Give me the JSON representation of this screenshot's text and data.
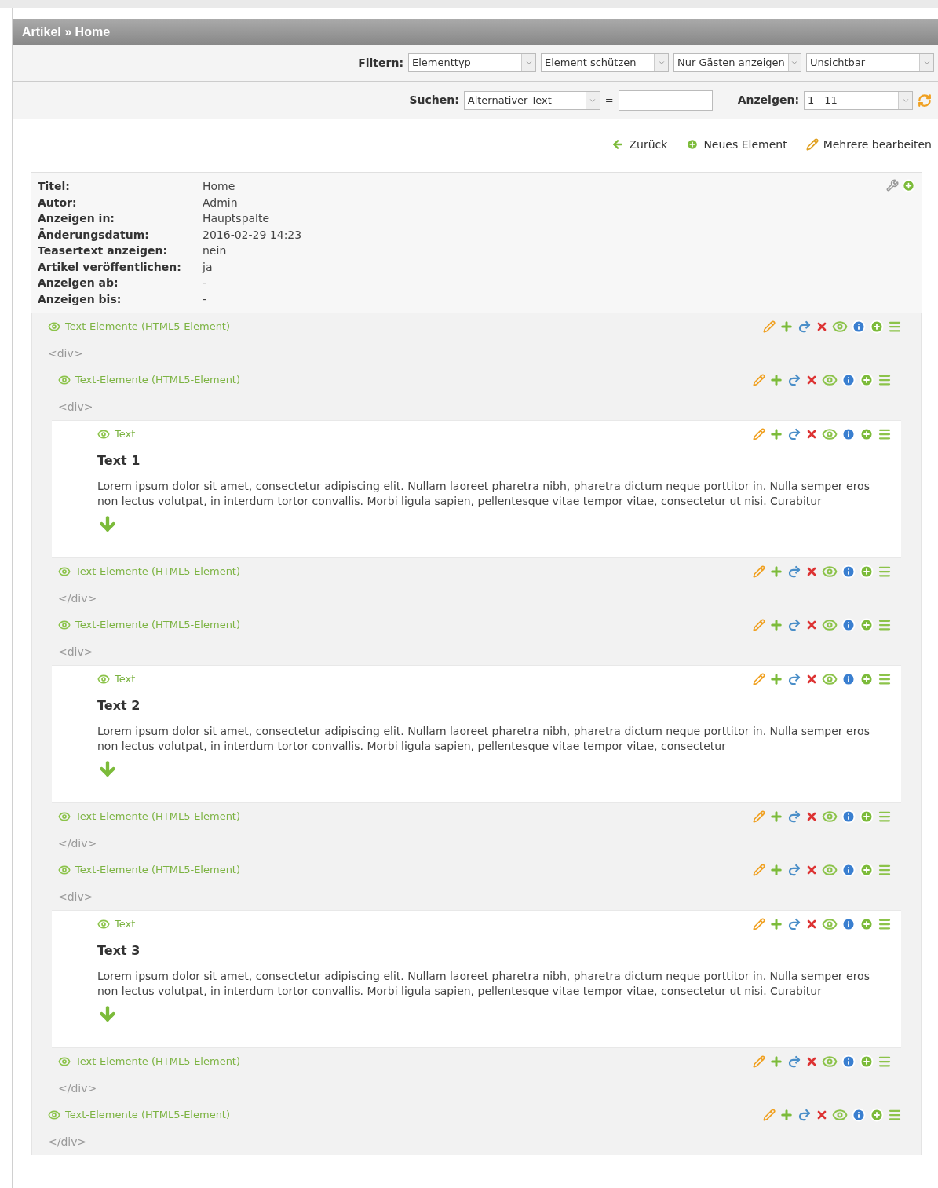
{
  "header": {
    "title": "Artikel » Home"
  },
  "filter": {
    "label": "Filtern:",
    "selects": [
      "Elementtyp",
      "Element schützen",
      "Nur Gästen anzeigen",
      "Unsichtbar"
    ]
  },
  "search": {
    "label": "Suchen:",
    "select": "Alternativer Text",
    "operator": "=",
    "show_label": "Anzeigen:",
    "show_select": "1 - 11"
  },
  "actions": [
    {
      "kind": "back",
      "label": "Zurück"
    },
    {
      "kind": "new",
      "label": "Neues Element"
    },
    {
      "kind": "edit",
      "label": "Mehrere bearbeiten"
    }
  ],
  "info": [
    {
      "label": "Titel:",
      "value": "Home"
    },
    {
      "label": "Autor:",
      "value": "Admin"
    },
    {
      "label": "Anzeigen in:",
      "value": "Hauptspalte"
    },
    {
      "label": "Änderungsdatum:",
      "value": "2016-02-29 14:23"
    },
    {
      "label": "Teasertext anzeigen:",
      "value": "nein"
    },
    {
      "label": "Artikel veröffentlichen:",
      "value": "ja"
    },
    {
      "label": "Anzeigen ab:",
      "value": "-"
    },
    {
      "label": "Anzeigen bis:",
      "value": "-"
    }
  ],
  "elements": [
    {
      "kind": "container",
      "label": "Text-Elemente (HTML5-Element)",
      "open_tag": "<div>",
      "close_label": "Text-Elemente (HTML5-Element)",
      "close_tag": "</div>",
      "children": [
        {
          "kind": "container",
          "label": "Text-Elemente (HTML5-Element)",
          "open_tag": "<div>",
          "close_label": "Text-Elemente (HTML5-Element)",
          "close_tag": "</div>",
          "children": [
            {
              "kind": "text",
              "label": "Text",
              "title": "Text 1",
              "body": "Lorem ipsum dolor sit amet, consectetur adipiscing elit. Nullam laoreet pharetra nibh, pharetra dictum neque porttitor in. Nulla semper eros non lectus volutpat, in interdum tortor convallis. Morbi ligula sapien, pellentesque vitae tempor vitae, consectetur ut nisi. Curabitur"
            }
          ]
        },
        {
          "kind": "container",
          "label": "Text-Elemente (HTML5-Element)",
          "open_tag": "<div>",
          "close_label": "Text-Elemente (HTML5-Element)",
          "close_tag": "</div>",
          "children": [
            {
              "kind": "text",
              "label": "Text",
              "title": "Text 2",
              "body": "Lorem ipsum dolor sit amet, consectetur adipiscing elit. Nullam laoreet pharetra nibh, pharetra dictum neque porttitor in. Nulla semper eros non lectus volutpat, in interdum tortor convallis. Morbi ligula sapien, pellentesque vitae tempor vitae, consectetur"
            }
          ]
        },
        {
          "kind": "container",
          "label": "Text-Elemente (HTML5-Element)",
          "open_tag": "<div>",
          "close_label": "Text-Elemente (HTML5-Element)",
          "close_tag": "</div>",
          "children": [
            {
              "kind": "text",
              "label": "Text",
              "title": "Text 3",
              "body": "Lorem ipsum dolor sit amet, consectetur adipiscing elit. Nullam laoreet pharetra nibh, pharetra dictum neque porttitor in. Nulla semper eros non lectus volutpat, in interdum tortor convallis. Morbi ligula sapien, pellentesque vitae tempor vitae, consectetur ut nisi. Curabitur"
            }
          ]
        }
      ]
    }
  ]
}
